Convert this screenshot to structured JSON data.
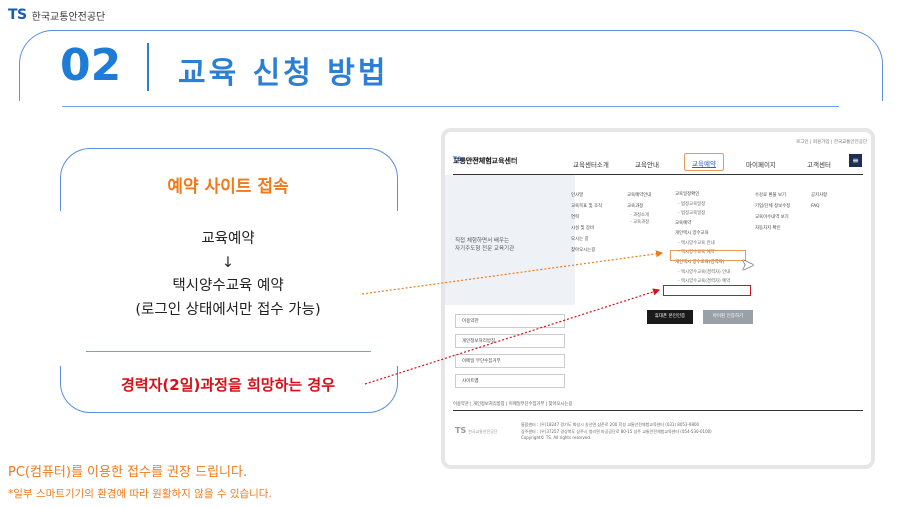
{
  "header": {
    "logo_mark": "TS",
    "org_name": "한국교통안전공단"
  },
  "section": {
    "number": "02",
    "title": "교육 신청 방법"
  },
  "card": {
    "heading": "예약 사이트 접속",
    "step1": "교육예약",
    "arrow": "↓",
    "step2": "택시양수교육 예약",
    "step3": "(로그인 상태에서만 접수 가능)",
    "career": "경력자(2일)과정을 희망하는 경우"
  },
  "notes": {
    "pc": "PC(컴퓨터)를 이용한 접수를 권장 드립니다.",
    "mobile": "*일부 스마트기기의 환경에 따라 원활하지 않을 수 있습니다."
  },
  "site": {
    "top_links": "로그인 | 회원가입 | 한국교통안전공단",
    "logo": "TS",
    "logo_org": "한국교통안전공단",
    "name": "교통안전체험교육센터",
    "nav": [
      "교육센터소개",
      "교육안내",
      "교육예약",
      "마이페이지",
      "고객센터"
    ],
    "banner_text_1": "직접 체험하면서 배우는",
    "banner_text_2": "자기주도형 전문 교육기관",
    "col1": [
      "인사말",
      "교육목표 및 조직",
      "연혁",
      "시설 및 장비",
      "오시는 길",
      "찾아오시는길"
    ],
    "col2": [
      "교육예약안내",
      "교육과정",
      "- 과정소개",
      "- 교육과정"
    ],
    "col3": [
      "교육일정확인",
      "- 법정교육일정",
      "- 법정교육일정",
      "교육예약",
      "개인택시 양수교육",
      "- 택시양수교육 안내",
      "- 택시양수교육 예약",
      "개인택시 양수교육(경력자)",
      "- 택시양수교육(경력자) 안내",
      "- 택시양수교육(경력자) 예약"
    ],
    "col4": [
      "수강료 환불 보기",
      "기업/단체 정보수정",
      "교육이수내역 보기",
      "자동차지 확인"
    ],
    "col5": [
      "공지사항",
      "FAQ"
    ],
    "side_items": [
      "이용약관",
      "개인정보처리방침",
      "이메일 무단수집거부",
      "사이트맵"
    ],
    "btn_dark": "휴대폰 본인인증",
    "btn_grey": "아이핀 인증하기",
    "footer_links": "이용약관  |  개인정보처리방침  |  이메일무단수집거부  |  찾아오시는길",
    "footer_addr_1": "통합센터 : (우)18247 경기도 화성시 송산면 삼존로 200 학성 교통안전체험교육센터 (031) 8053-9800",
    "footer_addr_2": "상주센터 : (우)37257 경상북도 상주시 청리면 마공공단로 80-15 상주 교통안전체험교육센터 (054-530-0100)",
    "footer_copy": "Copyright© TS. All rights reserved."
  },
  "colors": {
    "blue": "#1e7bd6",
    "orange": "#f07a1a",
    "red": "#d6101a"
  }
}
